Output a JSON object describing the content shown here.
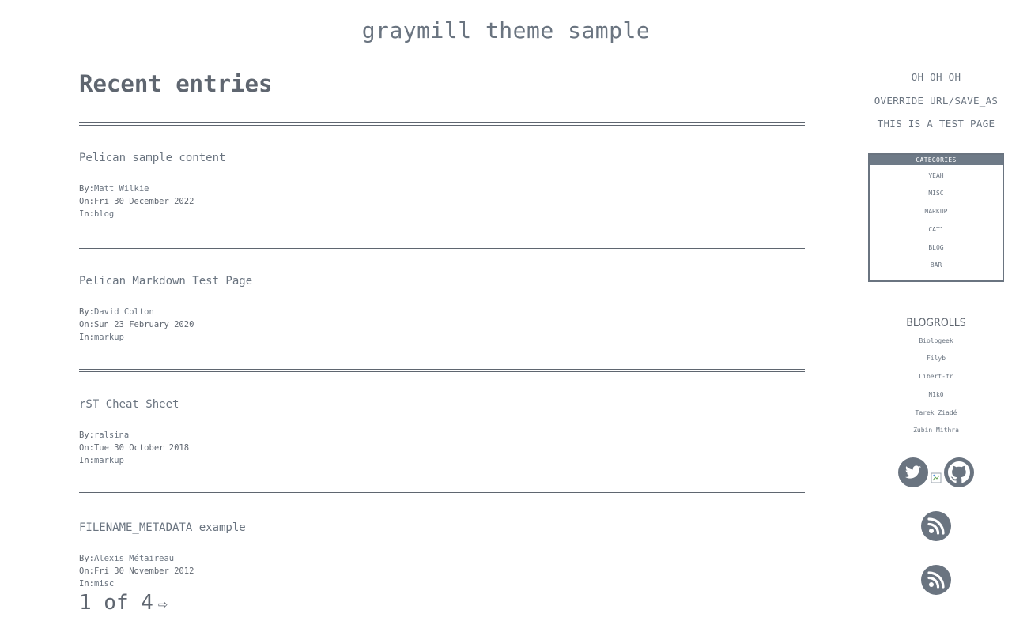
{
  "site": {
    "title": "graymill theme sample"
  },
  "main": {
    "heading": "Recent entries",
    "articles": [
      {
        "title": "Pelican sample content",
        "by_label": "By:",
        "author": "Matt Wilkie",
        "on_label": "On:",
        "date": "Fri 30 December 2022",
        "in_label": "In:",
        "category": "blog"
      },
      {
        "title": "Pelican Markdown Test Page",
        "by_label": "By:",
        "author": "David Colton",
        "on_label": "On:",
        "date": "Sun 23 February 2020",
        "in_label": "In:",
        "category": "markup"
      },
      {
        "title": "rST Cheat Sheet",
        "by_label": "By:",
        "author": "ralsina",
        "on_label": "On:",
        "date": "Tue 30 October 2018",
        "in_label": "In:",
        "category": "markup"
      },
      {
        "title": "FILENAME_METADATA example",
        "by_label": "By:",
        "author": "Alexis Métaireau",
        "on_label": "On:",
        "date": "Fri 30 November 2012",
        "in_label": "In:",
        "category": "misc"
      }
    ],
    "pager": {
      "text": "1 of 4",
      "next_arrow": "⇨"
    }
  },
  "sidebar": {
    "pages": [
      "OH OH OH",
      "OVERRIDE URL/SAVE_AS",
      "THIS IS A TEST PAGE"
    ],
    "categories": {
      "title": "CATEGORIES",
      "items": [
        "YEAH",
        "MISC",
        "MARKUP",
        "CAT1",
        "BLOG",
        "BAR"
      ]
    },
    "blogrolls": {
      "title": "BLOGROLLS",
      "items": [
        "Biologeek",
        "Filyb",
        "Libert-fr",
        "N1k0",
        "Tarek Ziadé",
        "Zubin Mithra"
      ]
    },
    "social": {
      "icons": [
        "twitter-icon",
        "broken-image-icon",
        "github-icon"
      ],
      "feeds": [
        "rss-icon",
        "rss-icon"
      ]
    }
  },
  "colors": {
    "text": "#5f6670",
    "link": "#6a7480",
    "category_header_bg": "#6e7a87"
  }
}
